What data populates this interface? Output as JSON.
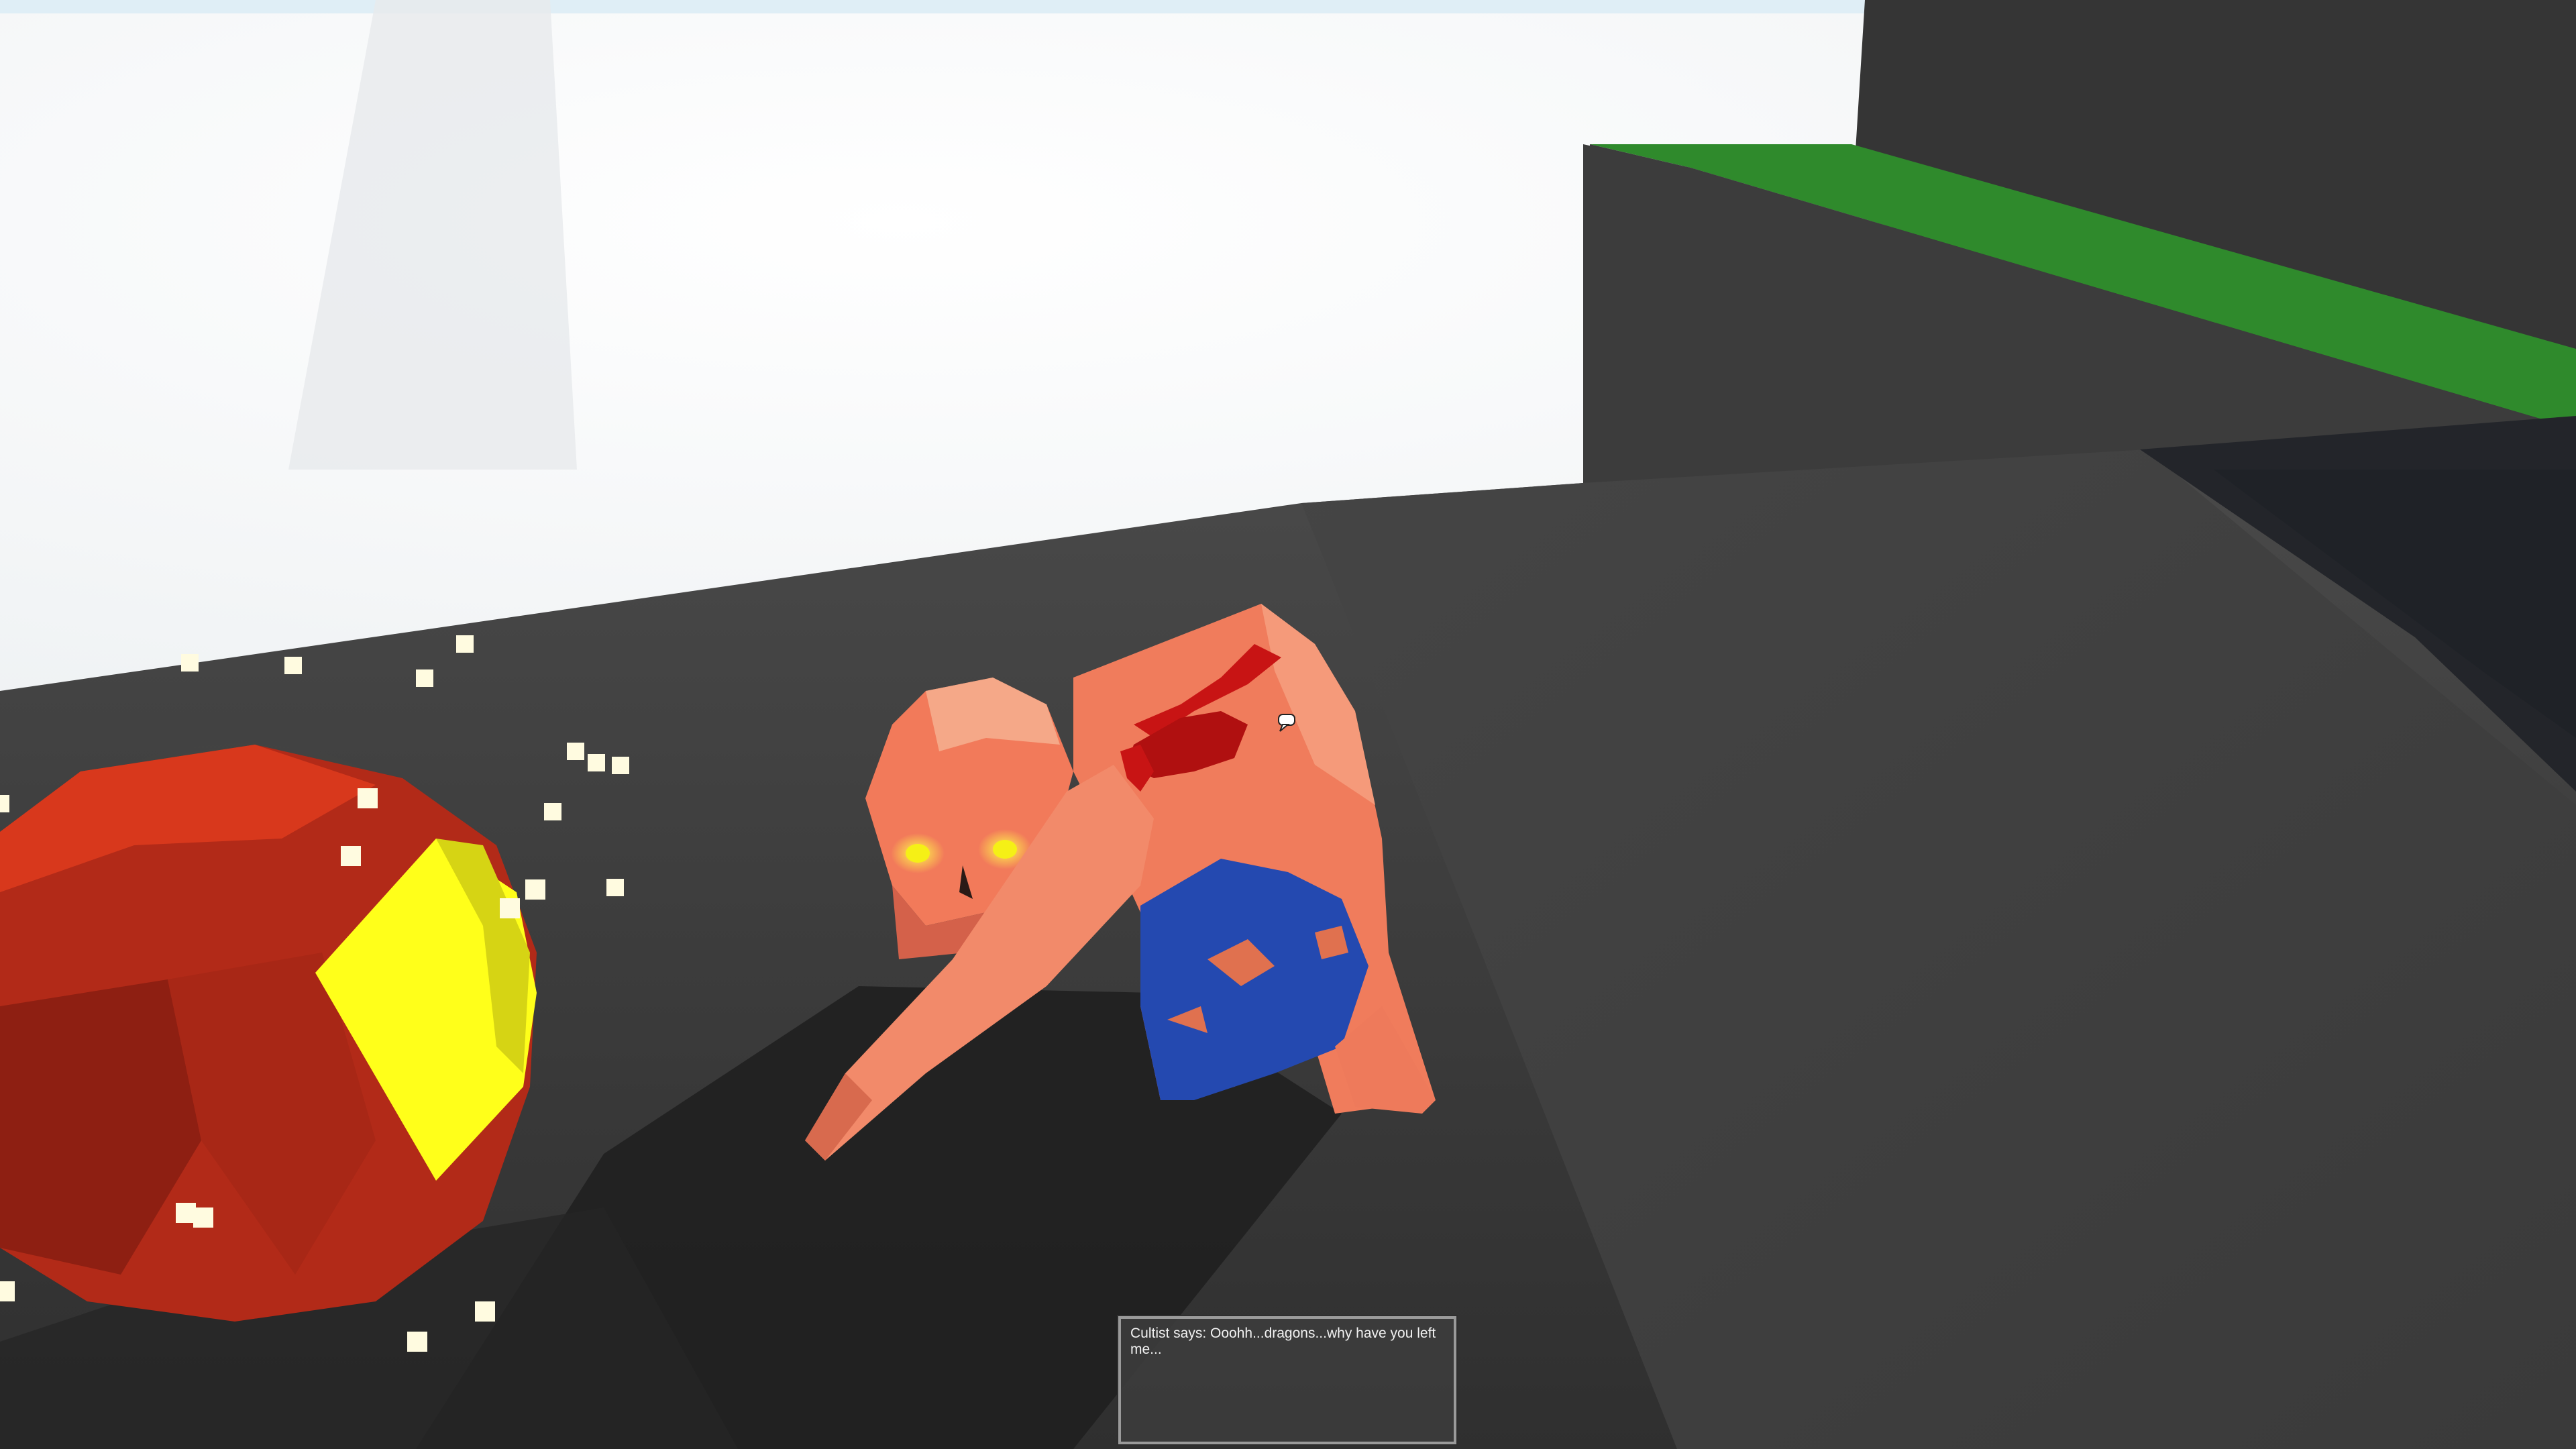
{
  "game": {
    "view": "first-person",
    "scene_objects": [
      {
        "name": "sky",
        "color": "#f5f7f8"
      },
      {
        "name": "rock-ground",
        "color": "#3d3d3d"
      },
      {
        "name": "grass-ledge",
        "color": "#2f8a2c"
      },
      {
        "name": "cliff-wall",
        "color": "#363636"
      },
      {
        "name": "dragon-egg",
        "color": "#c0281a",
        "glow_color": "#ffff1a"
      },
      {
        "name": "cultist",
        "color": "#f27a5a",
        "robe_color": "#2449b0",
        "blood_color": "#c81414",
        "eye_color": "#f5f016"
      },
      {
        "name": "glowing-particles",
        "color": "#fffbe0"
      }
    ]
  },
  "chat": {
    "message": "Cultist says: Ooohh...dragons...why have you left me..."
  },
  "indicators": {
    "speech_bubble_icon": "speech-bubble-icon"
  }
}
